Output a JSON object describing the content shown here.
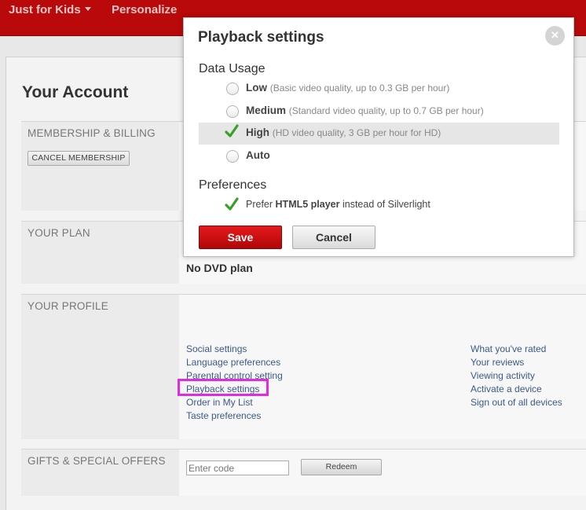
{
  "nav": {
    "just_for_kids": "Just for Kids",
    "personalize": "Personalize"
  },
  "account": {
    "title": "Your Account",
    "membership": {
      "label": "MEMBERSHIP & BILLING",
      "cancel_button": "CANCEL MEMBERSHIP"
    },
    "plan": {
      "label": "YOUR PLAN",
      "dvd_plan": "No DVD plan"
    },
    "profile": {
      "label": "YOUR PROFILE",
      "left_links": [
        "Social settings",
        "Language preferences",
        "Parental control setting",
        "Playback settings",
        "Order in My List",
        "Taste preferences"
      ],
      "right_links": [
        "What you've rated",
        "Your reviews",
        "Viewing activity",
        "Activate a device",
        "Sign out of all devices"
      ]
    },
    "gifts": {
      "label": "GIFTS & SPECIAL OFFERS",
      "code_placeholder": "Enter code",
      "redeem_button": "Redeem"
    }
  },
  "dialog": {
    "title": "Playback settings",
    "close_icon": "×",
    "data_usage_heading": "Data Usage",
    "options": [
      {
        "name": "Low",
        "desc": "(Basic video quality, up to 0.3 GB per hour)",
        "selected": false
      },
      {
        "name": "Medium",
        "desc": "(Standard video quality, up to 0.7 GB per hour)",
        "selected": false
      },
      {
        "name": "High",
        "desc": "(HD video quality, 3 GB per hour for HD)",
        "selected": true
      },
      {
        "name": "Auto",
        "desc": "",
        "selected": false
      }
    ],
    "preferences_heading": "Preferences",
    "pref_prefix": "Prefer",
    "pref_bold": "HTML5 player",
    "pref_suffix": "instead of Silverlight",
    "pref_checked": true,
    "save_button": "Save",
    "cancel_button": "Cancel"
  },
  "colors": {
    "brand_red": "#b9090b",
    "highlight": "#e02be0",
    "check_green": "#3a9e2a"
  }
}
